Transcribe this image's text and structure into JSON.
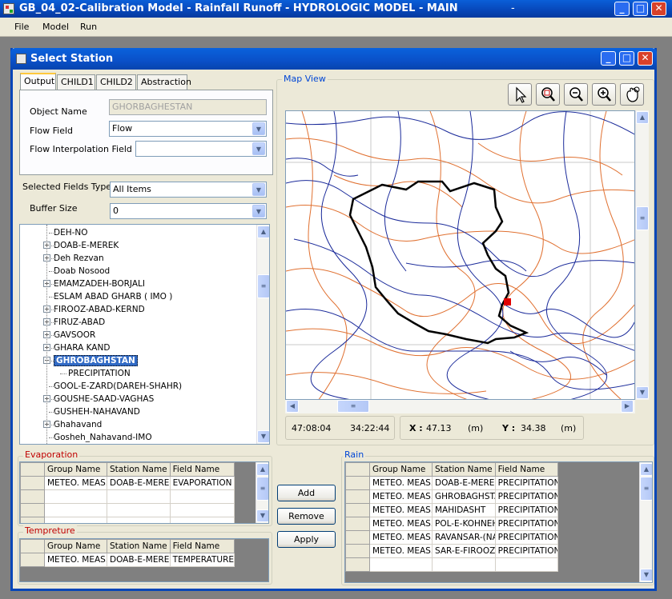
{
  "window": {
    "title": "GB_04_02-Calibration Model - Rainfall Runoff - HYDROLOGIC MODEL - MAIN"
  },
  "menu": [
    "File",
    "Model",
    "Run"
  ],
  "dialog": {
    "title": "Select Station"
  },
  "tabs": [
    "Output",
    "CHILD1",
    "CHILD2",
    "Abstraction"
  ],
  "output": {
    "object_name_label": "Object Name",
    "object_name_value": "GHORBAGHESTAN",
    "flow_field_label": "Flow Field",
    "flow_field_value": "Flow",
    "flow_interp_label": "Flow Interpolation Field",
    "flow_interp_value": ""
  },
  "selected_fields": {
    "label": "Selected Fields Type",
    "value": "All Items"
  },
  "buffer": {
    "label": "Buffer Size",
    "value": "0"
  },
  "tree": [
    {
      "label": "DEH-NO",
      "expandable": false
    },
    {
      "label": "DOAB-E-MEREK",
      "expandable": true
    },
    {
      "label": "Deh Rezvan",
      "expandable": true
    },
    {
      "label": "Doab Nosood",
      "expandable": false
    },
    {
      "label": "EMAMZADEH-BORJALI",
      "expandable": true
    },
    {
      "label": "ESLAM ABAD GHARB ( IMO )",
      "expandable": false
    },
    {
      "label": "FIROOZ-ABAD-KERND",
      "expandable": true
    },
    {
      "label": "FIRUZ-ABAD",
      "expandable": true
    },
    {
      "label": "GAVSOOR",
      "expandable": true
    },
    {
      "label": "GHARA KAND",
      "expandable": true
    },
    {
      "label": "GHROBAGHSTAN",
      "expandable": true,
      "selected": true
    },
    {
      "label": "PRECIPITATION",
      "expandable": false,
      "child": true
    },
    {
      "label": "GOOL-E-ZARD(DAREH-SHAHR)",
      "expandable": false
    },
    {
      "label": "GOUSHE-SAAD-VAGHAS",
      "expandable": true
    },
    {
      "label": "GUSHEH-NAHAVAND",
      "expandable": false
    },
    {
      "label": "Ghahavand",
      "expandable": true
    },
    {
      "label": "Gosheh_Nahavand-IMO",
      "expandable": false
    }
  ],
  "map": {
    "label": "Map View",
    "tools": [
      "pointer-icon",
      "zoom-box-icon",
      "zoom-out-icon",
      "zoom-in-icon",
      "pan-icon"
    ],
    "coord_left": "47:08:04",
    "coord_right": "34:22:44",
    "x_label": "X :",
    "x_value": "47.13",
    "x_unit": "(m)",
    "y_label": "Y :",
    "y_value": "34.38",
    "y_unit": "(m)"
  },
  "evaporation": {
    "label": "Evaporation",
    "headers": [
      "Group Name",
      "Station Name",
      "Field Name"
    ],
    "rows": [
      [
        "METEO. MEAS.",
        "DOAB-E-MEREK",
        "EVAPORATION"
      ]
    ]
  },
  "temperature": {
    "label": "Tempreture",
    "headers": [
      "Group Name",
      "Station Name",
      "Field Name"
    ],
    "rows": [
      [
        "METEO. MEAS.",
        "DOAB-E-MEREK",
        "TEMPERATURE"
      ]
    ]
  },
  "rain": {
    "label": "Rain",
    "headers": [
      "Group Name",
      "Station Name",
      "Field Name"
    ],
    "rows": [
      [
        "METEO. MEAS.",
        "DOAB-E-MEREK",
        "PRECIPITATION"
      ],
      [
        "METEO. MEAS.",
        "GHROBAGHSTA",
        "PRECIPITATION"
      ],
      [
        "METEO. MEAS.",
        "MAHIDASHT",
        "PRECIPITATION"
      ],
      [
        "METEO. MEAS.",
        "POL-E-KOHNEH",
        "PRECIPITATION"
      ],
      [
        "METEO. MEAS.",
        "RAVANSAR-(NA",
        "PRECIPITATION"
      ],
      [
        "METEO. MEAS.",
        "SAR-E-FIROOZ-A",
        "PRECIPITATION"
      ]
    ]
  },
  "buttons": {
    "add": "Add",
    "remove": "Remove",
    "apply": "Apply"
  }
}
